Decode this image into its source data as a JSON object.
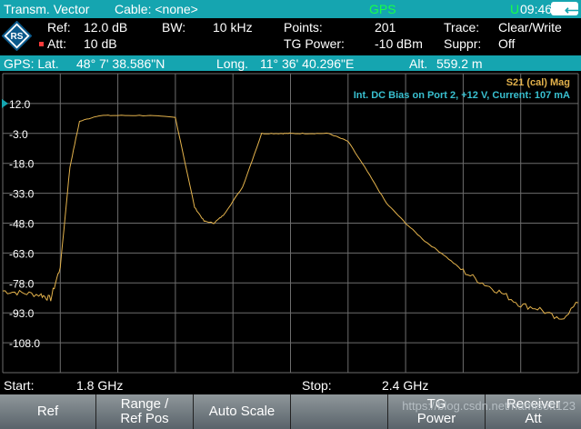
{
  "status_bar": {
    "mode": "Transm. Vector",
    "cable": "Cable: <none>",
    "gps": "GPS",
    "u_indicator": "U",
    "time": "09:46",
    "back_icon": "back-arrow-icon"
  },
  "settings": {
    "ref_label": "Ref:",
    "ref_value": "12.0 dB",
    "bw_label": "BW:",
    "bw_value": "10 kHz",
    "points_label": "Points:",
    "points_value": "201",
    "trace_label": "Trace:",
    "trace_value": "Clear/Write",
    "att_label": "Att:",
    "att_value": "10 dB",
    "tg_label": "TG Power:",
    "tg_value": "-10 dBm",
    "suppr_label": "Suppr:",
    "suppr_value": "Off"
  },
  "gps_line": {
    "lat_label": "GPS: Lat.",
    "lat_value": "48°  7' 38.586\"N",
    "long_label": "Long.",
    "long_value": "11° 36' 40.296\"E",
    "alt_label": "Alt.",
    "alt_value": "559.2 m"
  },
  "plot": {
    "trace_label": "S21 (cal) Mag",
    "bias_label": "Int. DC Bias on Port 2, +12 V, Current: 107 mA"
  },
  "chart_data": {
    "type": "line",
    "ylabel_ticks": [
      "12.0",
      "-3.0",
      "-18.0",
      "-33.0",
      "-48.0",
      "-63.0",
      "-78.0",
      "-93.0",
      "-108.0"
    ],
    "y_tick_values": [
      12,
      -3,
      -18,
      -33,
      -48,
      -63,
      -78,
      -93,
      -108
    ],
    "ylim": [
      -123,
      27
    ],
    "xlim": [
      1.8,
      2.4
    ],
    "x_unit": "GHz",
    "grid": true,
    "series": [
      {
        "x": [
          1.8,
          1.82,
          1.84,
          1.85,
          1.86,
          1.87,
          1.88,
          1.9,
          1.92,
          1.95,
          1.98,
          2.0,
          2.01,
          2.02,
          2.03,
          2.05,
          2.07,
          2.09,
          2.1,
          2.12,
          2.14,
          2.16,
          2.18,
          2.2,
          2.22,
          2.24,
          2.26,
          2.28,
          2.3,
          2.32,
          2.34,
          2.36,
          2.38,
          2.4
        ],
        "values": [
          -82,
          -83,
          -84,
          -86,
          -70,
          -20,
          3,
          6,
          6,
          6,
          5,
          -40,
          -47,
          -48,
          -44,
          -30,
          -3,
          -3,
          -3,
          -3,
          -3,
          -7,
          -22,
          -38,
          -48,
          -57,
          -64,
          -72,
          -78,
          -83,
          -89,
          -91,
          -97,
          -88
        ]
      }
    ]
  },
  "bottom_info": {
    "start_label": "Start:",
    "start_value": "1.8 GHz",
    "stop_label": "Stop:",
    "stop_value": "2.4 GHz"
  },
  "softkeys": {
    "ref": "Ref",
    "range_line1": "Range /",
    "range_line2": "Ref Pos",
    "auto_scale": "Auto Scale",
    "blank": "",
    "tg_line1": "TG",
    "tg_line2": "Power",
    "receiver_line1": "Receiver",
    "receiver_line2": "Att"
  },
  "watermark": "https://blog.csdn.net/namisoft123",
  "colors": {
    "accent": "#15a5b0",
    "trace": "#e3b24c",
    "gps_green": "#17ff4a",
    "bias_text": "#39c0d0"
  }
}
